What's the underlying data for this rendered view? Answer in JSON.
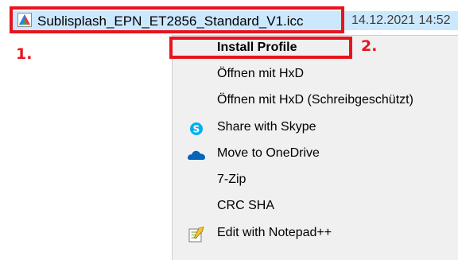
{
  "file": {
    "name": "Sublisplash_EPN_ET2856_Standard_V1.icc",
    "date": "14.12.2021 14:52"
  },
  "annotations": {
    "step1": "1.",
    "step2": "2."
  },
  "menu": {
    "items": [
      {
        "label": "Install Profile",
        "icon": ""
      },
      {
        "label": "Öffnen mit HxD",
        "icon": ""
      },
      {
        "label": "Öffnen mit HxD (Schreibgeschützt)",
        "icon": ""
      },
      {
        "label": "Share with Skype",
        "icon": "skype-icon"
      },
      {
        "label": "Move to OneDrive",
        "icon": "onedrive-icon"
      },
      {
        "label": "7-Zip",
        "icon": ""
      },
      {
        "label": "CRC SHA",
        "icon": ""
      },
      {
        "label": "Edit with Notepad++",
        "icon": "notepad-plus-plus-icon"
      }
    ]
  },
  "colors": {
    "annotation_red": "#e8141d",
    "selection_blue": "#cce8ff",
    "menu_bg": "#f0f0f0"
  }
}
